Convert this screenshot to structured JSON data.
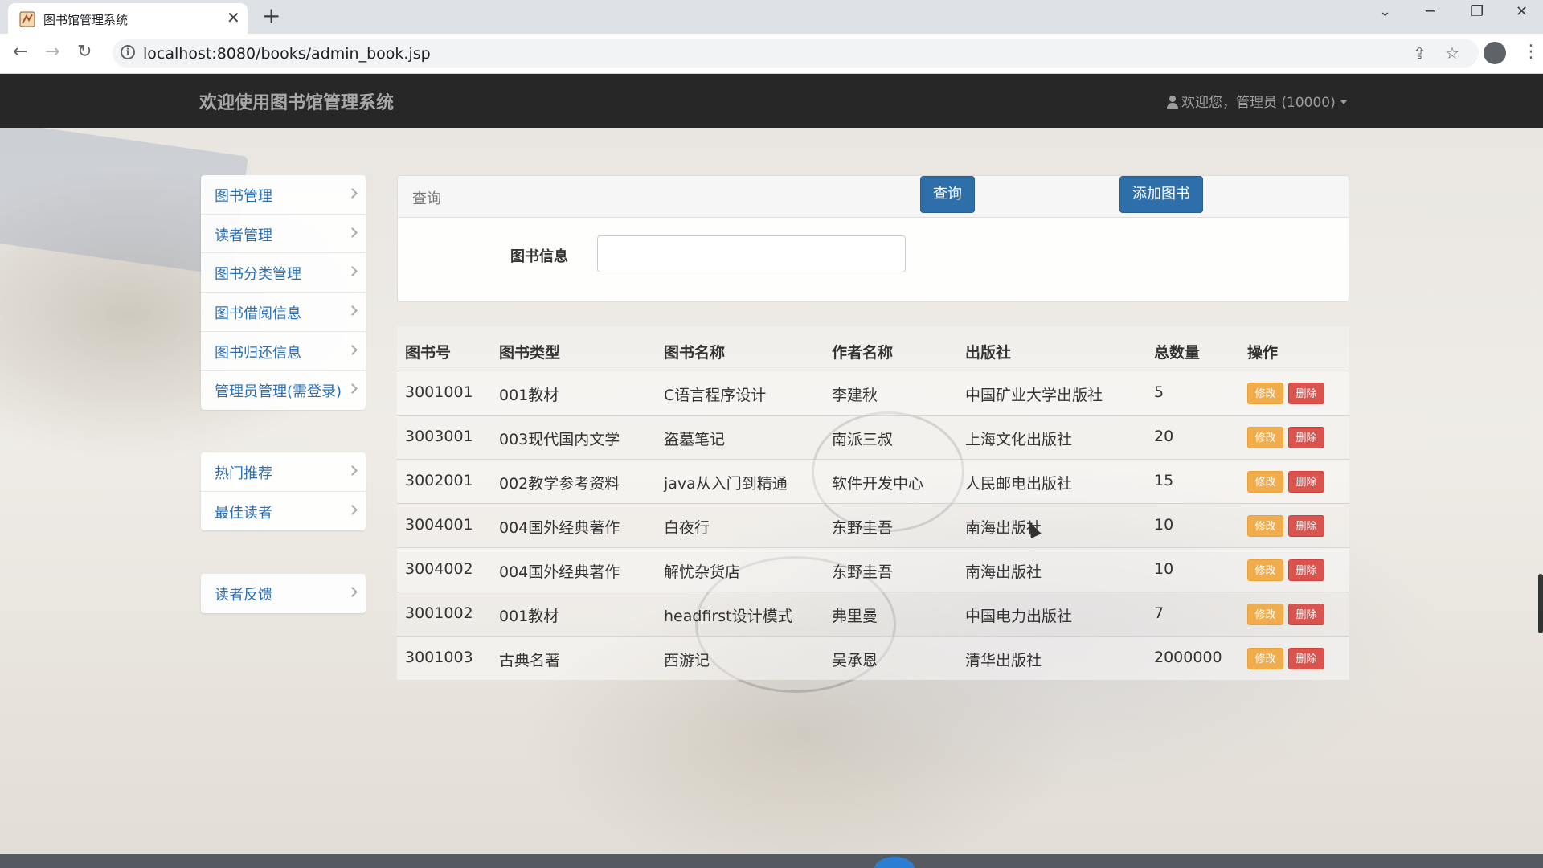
{
  "browser": {
    "tab_title": "图书馆管理系统",
    "url": "localhost:8080/books/admin_book.jsp"
  },
  "navbar": {
    "brand": "欢迎使用图书馆管理系统",
    "user": "欢迎您，管理员 (10000)"
  },
  "sidebar": {
    "group1": [
      {
        "label": "图书管理"
      },
      {
        "label": "读者管理"
      },
      {
        "label": "图书分类管理"
      },
      {
        "label": "图书借阅信息"
      },
      {
        "label": "图书归还信息"
      },
      {
        "label": "管理员管理(需登录)"
      }
    ],
    "group2": [
      {
        "label": "热门推荐"
      },
      {
        "label": "最佳读者"
      }
    ],
    "group3": [
      {
        "label": "读者反馈"
      }
    ]
  },
  "search": {
    "panel_title": "查询",
    "field_label": "图书信息",
    "value": "",
    "query_button": "查询",
    "add_button": "添加图书"
  },
  "table": {
    "columns": [
      "图书号",
      "图书类型",
      "图书名称",
      "作者名称",
      "出版社",
      "总数量",
      "操作"
    ],
    "edit_label": "修改",
    "delete_label": "删除",
    "rows": [
      [
        "3001001",
        "001教材",
        "C语言程序设计",
        "李建秋",
        "中国矿业大学出版社",
        "5"
      ],
      [
        "3003001",
        "003现代国内文学",
        "盗墓笔记",
        "南派三叔",
        "上海文化出版社",
        "20"
      ],
      [
        "3002001",
        "002教学参考资料",
        "java从入门到精通",
        "软件开发中心",
        "人民邮电出版社",
        "15"
      ],
      [
        "3004001",
        "004国外经典著作",
        "白夜行",
        "东野圭吾",
        "南海出版社",
        "10"
      ],
      [
        "3004002",
        "004国外经典著作",
        "解忧杂货店",
        "东野圭吾",
        "南海出版社",
        "10"
      ],
      [
        "3001002",
        "001教材",
        "headfirst设计模式",
        "弗里曼",
        "中国电力出版社",
        "7"
      ],
      [
        "3001003",
        "古典名著",
        "西游记",
        "吴承恩",
        "清华出版社",
        "2000000"
      ]
    ]
  }
}
